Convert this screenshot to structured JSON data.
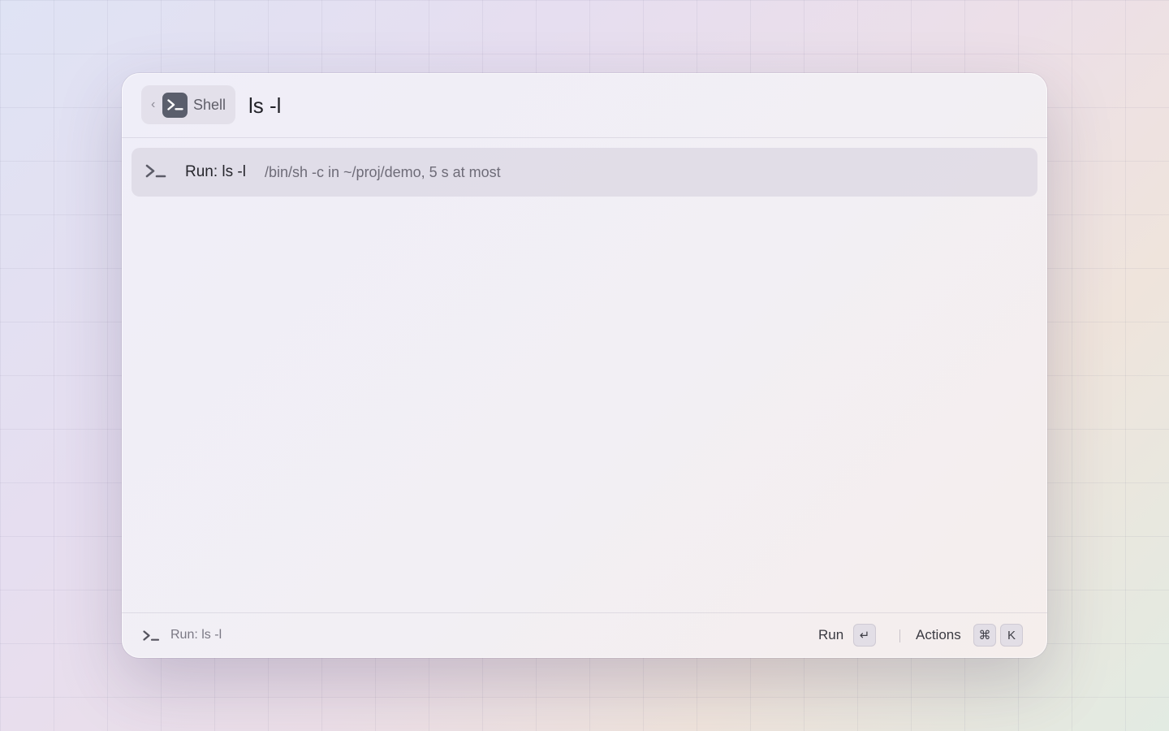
{
  "header": {
    "back_chip_label": "Shell",
    "search_value": "ls -l"
  },
  "results": [
    {
      "title": "Run: ls -l",
      "subtitle": "/bin/sh -c in ~/proj/demo, 5 s at most",
      "icon": "terminal-icon"
    }
  ],
  "footer": {
    "selected_label": "Run: ls -l",
    "primary_action_label": "Run",
    "primary_action_key": "↵",
    "actions_label": "Actions",
    "actions_key_modifier": "⌘",
    "actions_key": "K"
  }
}
